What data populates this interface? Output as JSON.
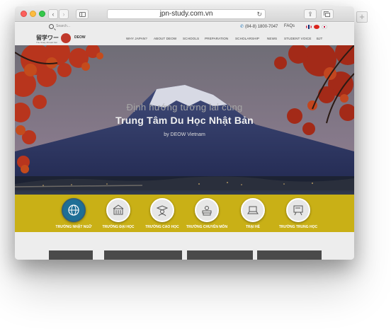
{
  "browser": {
    "url": "jpn-study.com.vn",
    "reload_icon": "reload-icon",
    "back_glyph": "‹",
    "forward_glyph": "›",
    "share_glyph": "⇪",
    "new_tab_glyph": "+"
  },
  "topbar": {
    "search_placeholder": "Search...",
    "phone": "(84-8) 1800-7047",
    "faqs": "FAQs"
  },
  "logo": {
    "japanese": "留学ワー",
    "brand": "DEOW",
    "tagline": "The Study Abroad Fair"
  },
  "nav": {
    "items": [
      "WHY JAPAN?",
      "ABOUT DEOW",
      "SCHOOLS",
      "PREPARATION",
      "SCHOLARSHIP",
      "NEWS",
      "STUDENT VOICE",
      "BJT"
    ]
  },
  "hero": {
    "line1": "Định hướng tương lai cùng",
    "line2": "Trung Tâm Du Học Nhật Bản",
    "line3": "by DEOW Vietnam"
  },
  "categories": [
    {
      "label": "TRƯỜNG NHẬT NGỮ",
      "icon": "globe-icon",
      "active": true
    },
    {
      "label": "TRƯỜNG ĐẠI HỌC",
      "icon": "building-icon",
      "active": false
    },
    {
      "label": "TRƯỜNG CAO HỌC",
      "icon": "graduate-icon",
      "active": false
    },
    {
      "label": "TRƯỜNG CHUYÊN MÔN",
      "icon": "books-icon",
      "active": false
    },
    {
      "label": "TRẠI HÈ",
      "icon": "laptop-icon",
      "active": false
    },
    {
      "label": "TRƯỜNG TRUNG HỌC",
      "icon": "whiteboard-icon",
      "active": false
    }
  ],
  "colors": {
    "category_bar": "#c9b016",
    "active_category": "#1f6f96",
    "logo_red": "#c0392b"
  }
}
